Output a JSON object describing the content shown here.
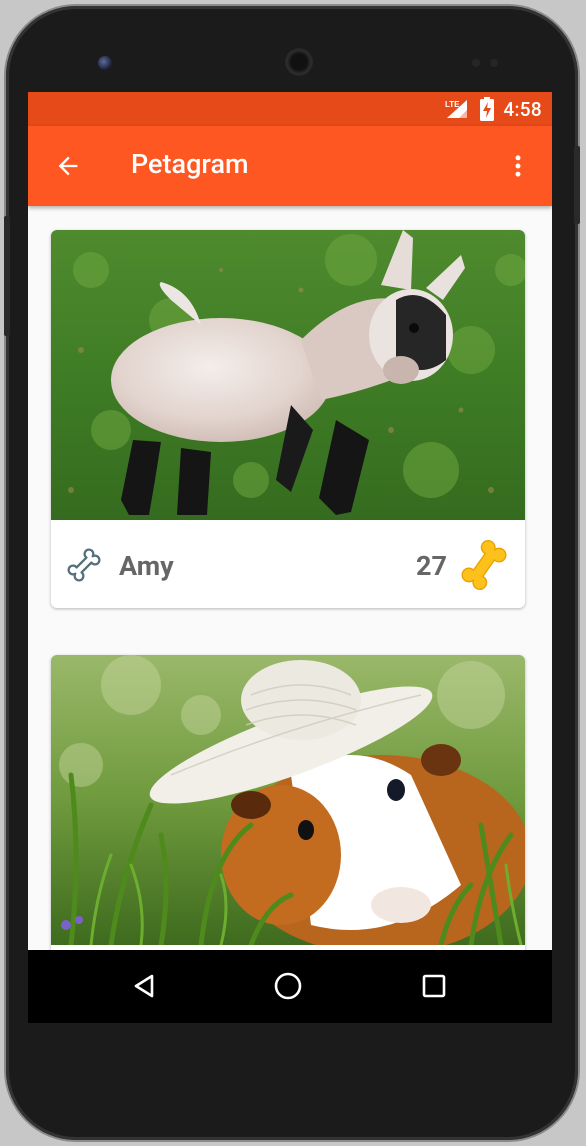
{
  "status_bar": {
    "network_label": "LTE",
    "time": "4:58"
  },
  "app_bar": {
    "title": "Petagram",
    "back_icon": "arrow-back-icon",
    "menu_icon": "more-vert-icon"
  },
  "pets": [
    {
      "name": "Amy",
      "likes": "27",
      "photo": "baby goat on grass",
      "rating_icon": "bone-outline-icon",
      "like_icon": "bone-filled-icon"
    },
    {
      "name": "",
      "likes": "",
      "photo": "guinea pig wearing straw hat in grass"
    }
  ],
  "nav_bar": {
    "back": "nav-back-icon",
    "home": "nav-home-icon",
    "recents": "nav-recents-icon"
  },
  "colors": {
    "primary": "#ff5722",
    "primary_dark": "#e64a19",
    "bone_gold": "#fcc21b"
  }
}
